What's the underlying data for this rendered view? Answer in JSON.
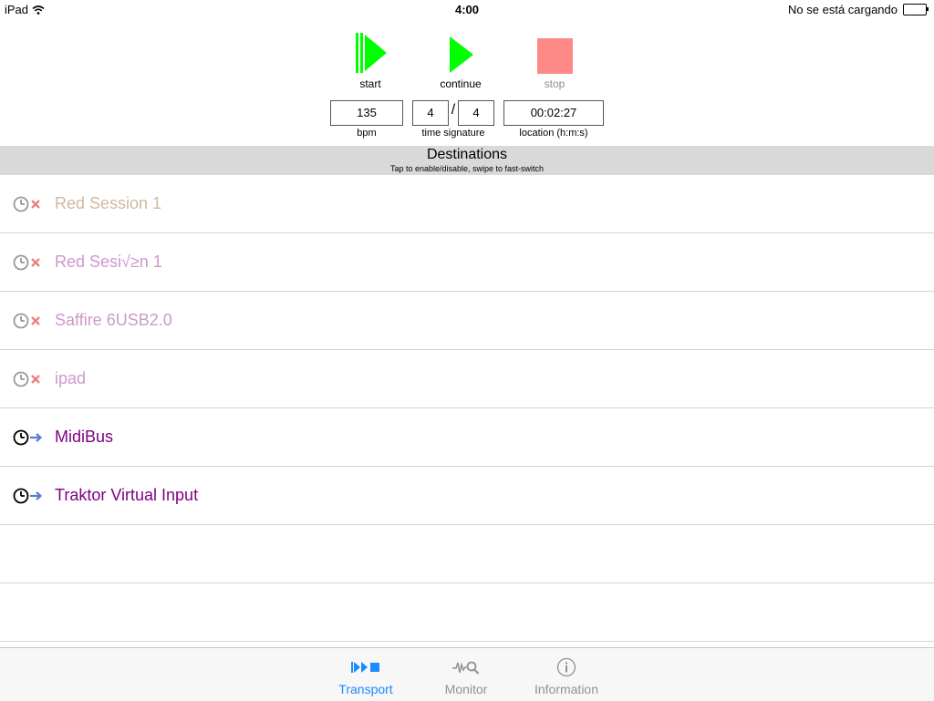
{
  "status_bar": {
    "device": "iPad",
    "time": "4:00",
    "battery_text": "No se está cargando"
  },
  "transport": {
    "start_label": "start",
    "continue_label": "continue",
    "stop_label": "stop"
  },
  "fields": {
    "bpm_value": "135",
    "bpm_label": "bpm",
    "time_sig_numerator": "4",
    "time_sig_slash": "/",
    "time_sig_denominator": "4",
    "time_sig_label": "time signature",
    "location_value": "00:02:27",
    "location_label": "location (h:m:s)"
  },
  "destinations": {
    "title": "Destinations",
    "subtitle": "Tap to enable/disable, swipe to fast-switch",
    "items": [
      {
        "name": "Red Session 1",
        "enabled": false,
        "color": "#d2b8a0"
      },
      {
        "name": "Red Sesi√≥n 1",
        "enabled": false,
        "color": "#cc99cc"
      },
      {
        "name": "Saffire 6USB2.0",
        "enabled": false,
        "color": "#cc99cc"
      },
      {
        "name": "ipad",
        "enabled": false,
        "color": "#cc99cc"
      },
      {
        "name": "MidiBus",
        "enabled": true,
        "color": "#800080"
      },
      {
        "name": "Traktor Virtual Input",
        "enabled": true,
        "color": "#800080"
      },
      {
        "name": "",
        "enabled": null,
        "color": "#000000"
      },
      {
        "name": "",
        "enabled": null,
        "color": "#000000"
      }
    ]
  },
  "tabs": {
    "transport": "Transport",
    "monitor": "Monitor",
    "information": "Information"
  },
  "colors": {
    "play_green": "#00ff00",
    "stop_red": "#ff8888",
    "tab_active": "#1a8cff",
    "tab_inactive": "#929292",
    "disabled_x": "#f08080",
    "enabled_arrow": "#5b7bd5"
  }
}
